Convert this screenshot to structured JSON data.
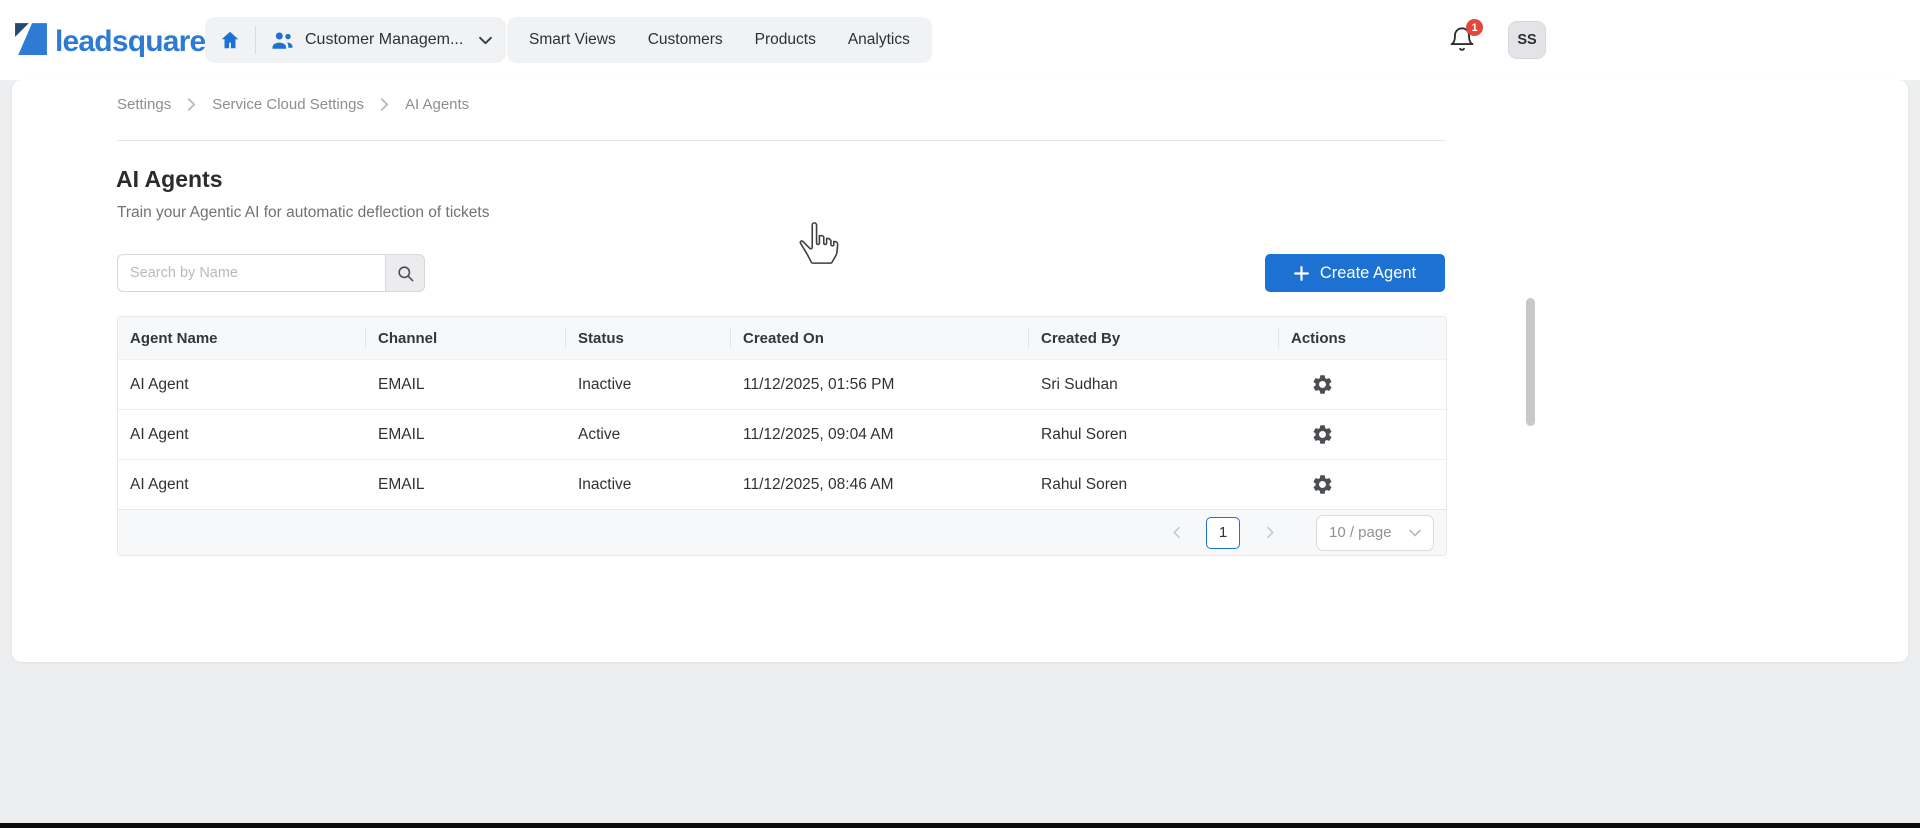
{
  "colors": {
    "accent": "#1d71d2",
    "notification_badge": "#e4483d",
    "logo_blue": "#2e7bd6",
    "logo_navy": "#24486e"
  },
  "header": {
    "logo_text": "leadsquared",
    "workspace_selector": "Customer Managem...",
    "nav_items": [
      "Smart Views",
      "Customers",
      "Products",
      "Analytics"
    ],
    "notification_count": "1",
    "avatar_initials": "SS"
  },
  "breadcrumb": [
    "Settings",
    "Service Cloud Settings",
    "AI Agents"
  ],
  "page": {
    "title": "AI Agents",
    "subtitle": "Train your Agentic AI for automatic deflection of tickets",
    "search_placeholder": "Search by Name",
    "create_button_label": "Create Agent"
  },
  "table": {
    "columns": [
      "Agent Name",
      "Channel",
      "Status",
      "Created On",
      "Created By",
      "Actions"
    ],
    "rows": [
      {
        "agent_name": "AI Agent",
        "channel": "EMAIL",
        "status": "Inactive",
        "created_on": "11/12/2025, 01:56 PM",
        "created_by": "Sri Sudhan"
      },
      {
        "agent_name": "AI Agent",
        "channel": "EMAIL",
        "status": "Active",
        "created_on": "11/12/2025, 09:04 AM",
        "created_by": "Rahul Soren"
      },
      {
        "agent_name": "AI Agent",
        "channel": "EMAIL",
        "status": "Inactive",
        "created_on": "11/12/2025, 08:46 AM",
        "created_by": "Rahul Soren"
      }
    ]
  },
  "pagination": {
    "current_page": "1",
    "page_size_label": "10 / page"
  }
}
